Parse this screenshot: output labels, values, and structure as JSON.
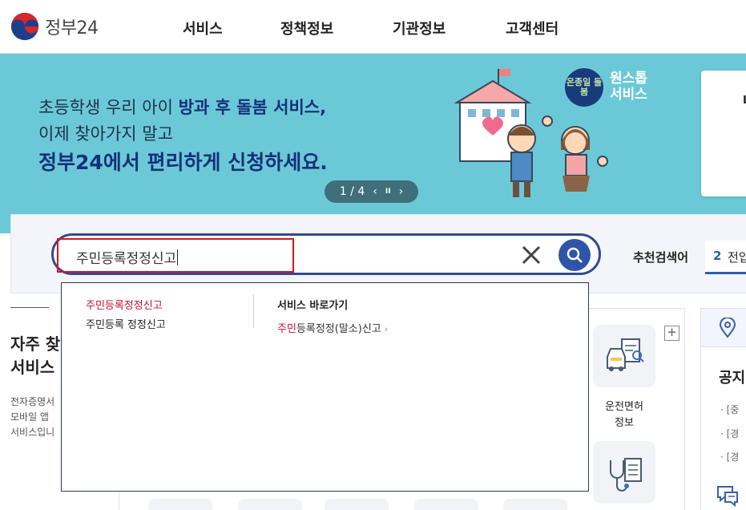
{
  "header": {
    "logo_text": "정부24",
    "nav": [
      "서비스",
      "정책정보",
      "기관정보",
      "고객센터"
    ]
  },
  "banner": {
    "line1_prefix": "초등학생 우리 아이 ",
    "line1_highlight": "방과 후 돌봄 서비스,",
    "line2": "이제 찾아가지 말고",
    "line3": "정부24에서 편리하게 신청하세요.",
    "pager": {
      "current": "1",
      "separator": "/",
      "total": "4",
      "prev": "‹",
      "pause": "II",
      "next": "›"
    },
    "onestop_badge": "온종일 돌봄",
    "onestop_line1": "원스톱",
    "onestop_line2": "서비스",
    "side_card_text": "L"
  },
  "search": {
    "value": "주민등록정정신고",
    "clear_icon": "close-icon",
    "search_icon": "search-icon",
    "recommend_label": "추천검색어",
    "recommend_tab_num": "2",
    "recommend_tab_text": "전입"
  },
  "autocomplete": {
    "suggestions": [
      "주민등록정정신고",
      "주민등록 정정신고"
    ],
    "shortcut_heading": "서비스 바로가기",
    "shortcut_match": "주민",
    "shortcut_rest": "등록정정(말소)신고",
    "shortcut_chevron": "›"
  },
  "faq": {
    "title_line1": "자주 찾",
    "title_line2": "서비스",
    "desc": [
      "전자증명서",
      "모바일 앱",
      "서비스입니"
    ]
  },
  "services": {
    "expand_label": "+",
    "tile1_label_line1": "운전면허",
    "tile1_label_line2": "정보"
  },
  "notice": {
    "title": "공지",
    "items": [
      "· [중",
      "· [경",
      "· [경"
    ]
  },
  "colors": {
    "banner_bg": "#6bc9d7",
    "brand_navy": "#16307a",
    "search_border": "#2e4b8f",
    "search_button": "#2f55a8",
    "match_red": "#c8102e",
    "highlight_red": "#d6161f"
  }
}
